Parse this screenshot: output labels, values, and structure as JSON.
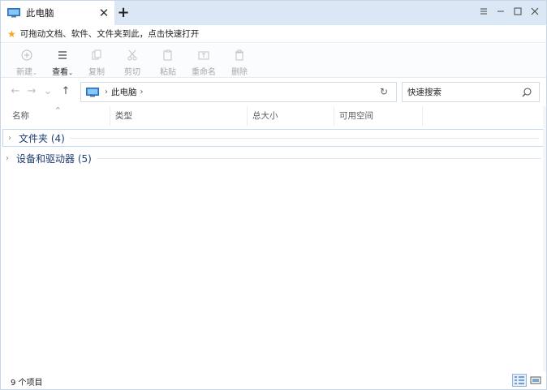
{
  "window": {
    "tab_title": "此电脑",
    "tab_close": "✕",
    "new_tab": "+",
    "controls": {
      "menu": "≡",
      "minimize": "—",
      "maximize": "☐",
      "close": "✕"
    }
  },
  "tip": {
    "icon": "star-icon",
    "text": "可拖动文档、软件、文件夹到此，点击快速打开"
  },
  "ribbon": [
    {
      "id": "new",
      "label": "新建",
      "icon": "new-icon",
      "caret": true,
      "enabled": false
    },
    {
      "id": "view",
      "label": "查看",
      "icon": "view-icon",
      "caret": true,
      "enabled": true
    },
    {
      "id": "copy",
      "label": "复制",
      "icon": "copy-icon",
      "caret": false,
      "enabled": false
    },
    {
      "id": "cut",
      "label": "剪切",
      "icon": "cut-icon",
      "caret": false,
      "enabled": false
    },
    {
      "id": "paste",
      "label": "粘贴",
      "icon": "paste-icon",
      "caret": false,
      "enabled": false
    },
    {
      "id": "rename",
      "label": "重命名",
      "icon": "rename-icon",
      "caret": false,
      "enabled": false
    },
    {
      "id": "delete",
      "label": "删除",
      "icon": "delete-icon",
      "caret": false,
      "enabled": false
    }
  ],
  "nav": {
    "back": "←",
    "forward": "→",
    "recent": "⌄",
    "up": "↑"
  },
  "address": {
    "crumbs": [
      "此电脑"
    ],
    "refresh": "↻"
  },
  "search": {
    "placeholder": "快速搜索"
  },
  "columns": [
    "名称",
    "类型",
    "总大小",
    "可用空间"
  ],
  "groups": [
    {
      "title": "文件夹 (4)",
      "expanded": false,
      "selected": true
    },
    {
      "title": "设备和驱动器 (5)",
      "expanded": false,
      "selected": false
    }
  ],
  "status": {
    "item_count": "9 个项目"
  },
  "colors": {
    "titlebar": "#dce7f5",
    "group_text": "#1e3d73",
    "accent": "#2f7fd1"
  }
}
